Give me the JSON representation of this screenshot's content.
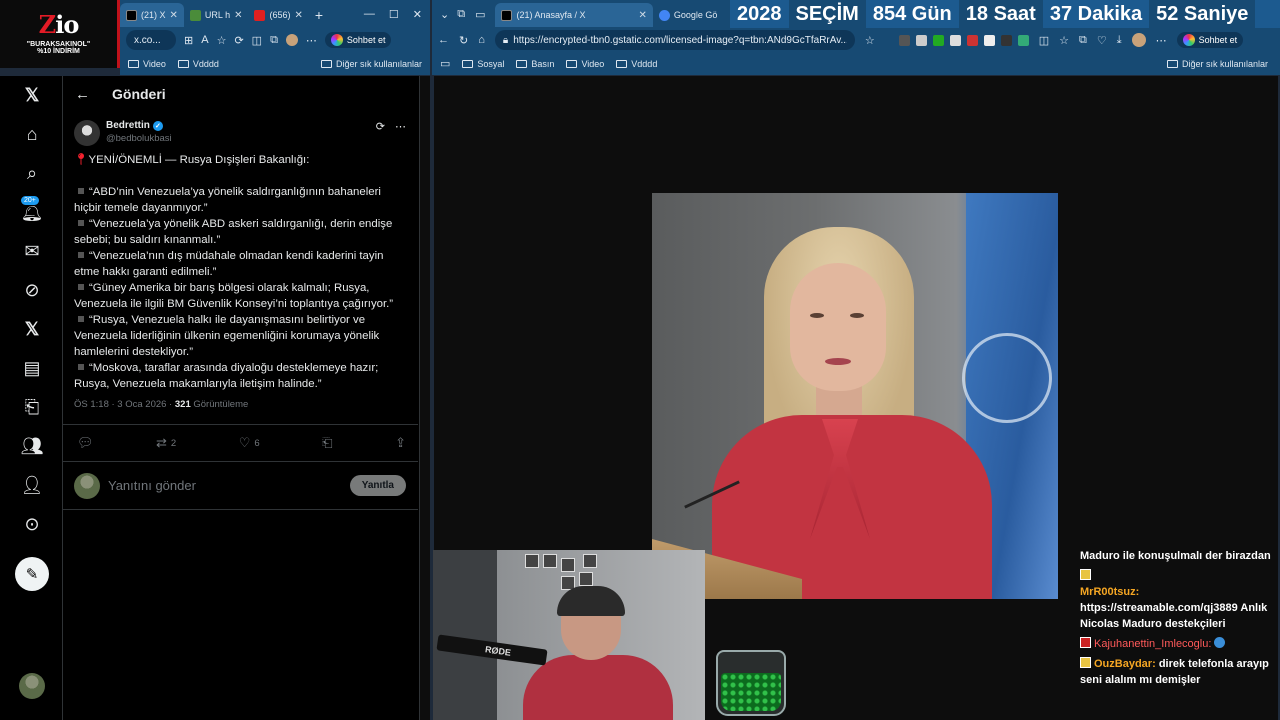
{
  "promo": {
    "logo_a": "Z",
    "logo_b": "i",
    "logo_c": "o",
    "line1": "\"BURAKSAKINOL\"",
    "line2": "%10 İNDİRİM"
  },
  "left_browser": {
    "tabs": [
      {
        "label": "(21) X"
      },
      {
        "label": "URL h"
      },
      {
        "label": "(656)"
      }
    ],
    "new_tab": "+",
    "address": "x.co...",
    "chat_label": "Sohbet et",
    "bookmarks": [
      "Video",
      "Vdddd"
    ],
    "other_bookmarks": "Diğer sık kullanılanlar"
  },
  "right_browser": {
    "tabs": [
      {
        "label": "(21) Anasayfa / X"
      },
      {
        "label": "Google Gö"
      }
    ],
    "address": "https://encrypted-tbn0.gstatic.com/licensed-image?q=tbn:ANd9GcTfaRrAv...",
    "chat_label": "Sohbet et",
    "bookmarks": [
      "Sosyal",
      "Basın",
      "Video",
      "Vdddd"
    ],
    "other_bookmarks": "Diğer sık kullanılanlar"
  },
  "countdown": {
    "year": "2028",
    "label": "SEÇİM",
    "days": "854 Gün",
    "hours": "18 Saat",
    "minutes": "37 Dakika",
    "seconds": "52 Saniye"
  },
  "twitter": {
    "header_title": "Gönderi",
    "nav_badge": "20+",
    "author_name": "Bedrettin",
    "author_handle": "@bedbolukbasi",
    "intro": "YENİ/ÖNEMLİ — Rusya Dışişleri Bakanlığı:",
    "points": [
      "“ABD’nin Venezuela’ya yönelik saldırganlığının bahaneleri hiçbir temele dayanmıyor.”",
      "“Venezuela’ya yönelik ABD askeri saldırganlığı, derin endişe sebebi; bu saldırı kınanmalı.”",
      "“Venezuela’nın dış müdahale olmadan kendi kaderini tayin etme hakkı garanti edilmeli.”",
      "“Güney Amerika bir barış bölgesi olarak kalmalı; Rusya, Venezuela ile ilgili BM Güvenlik Konseyi’ni toplantıya çağırıyor.”",
      "“Rusya, Venezuela halkı ile dayanışmasını belirtiyor ve Venezuela liderliğinin ülkenin egemenliğini korumaya yönelik hamlelerini destekliyor.”",
      "“Moskova, taraflar arasında diyaloğu desteklemeye hazır; Rusya, Venezuela makamlarıyla iletişim halinde.”"
    ],
    "time": "ÖS 1:18 · 3 Oca 2026 ·",
    "views_count": "321",
    "views_label": "Görüntüleme",
    "retweets": "2",
    "likes": "6",
    "reply_placeholder": "Yanıtını gönder",
    "reply_button": "Yanıtla"
  },
  "chat": {
    "first": "Maduro ile konuşulmalı der birazdan",
    "messages": [
      {
        "user": "MrR00tsuz:",
        "text": "https://streamable.com/qj3889 Anlık Nicolas Maduro destekçileri"
      },
      {
        "user": "Kajuhanettin_Imlecoglu:",
        "text": ""
      },
      {
        "user": "OuzBaydar:",
        "text": "direk telefonla arayıp seni alalım mı demişler"
      }
    ]
  }
}
